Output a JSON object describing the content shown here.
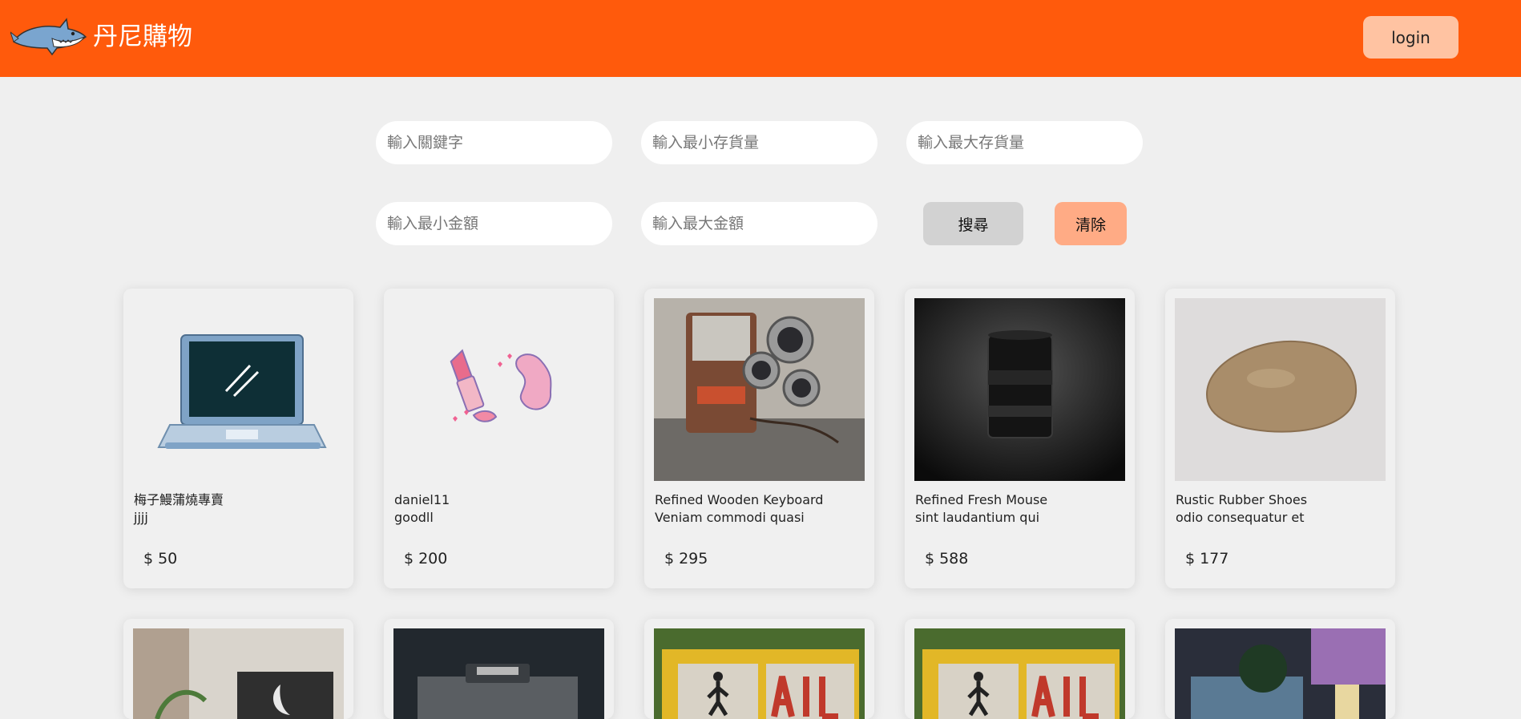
{
  "header": {
    "brand": "丹尼購物",
    "login_label": "login"
  },
  "filters": {
    "keyword_placeholder": "輸入關鍵字",
    "min_stock_placeholder": "輸入最小存貨量",
    "max_stock_placeholder": "輸入最大存貨量",
    "min_price_placeholder": "輸入最小金額",
    "max_price_placeholder": "輸入最大金額",
    "search_label": "搜尋",
    "clear_label": "清除"
  },
  "products": [
    {
      "title": "梅子鰻蒲燒專賣",
      "desc": "jjjj",
      "currency": "$",
      "price": "50",
      "image": "laptop-illustration"
    },
    {
      "title": "daniel11",
      "desc": "goodll",
      "currency": "$",
      "price": "200",
      "image": "cosmetics-illustration"
    },
    {
      "title": "Refined Wooden Keyboard",
      "desc": "Veniam commodi quasi",
      "currency": "$",
      "price": "295",
      "image": "vintage-movie-camera-photo"
    },
    {
      "title": "Refined Fresh Mouse",
      "desc": "sint laudantium qui",
      "currency": "$",
      "price": "588",
      "image": "camera-lens-photo"
    },
    {
      "title": "Rustic Rubber Shoes",
      "desc": "odio consequatur et",
      "currency": "$",
      "price": "177",
      "image": "rock-photo"
    }
  ],
  "row2_images": [
    "plant-and-pillow-photo",
    "fujifilm-camera-photo",
    "pedestrian-signal-photo",
    "pedestrian-signal-photo",
    "night-street-photo"
  ],
  "colors": {
    "header_bg": "#ff5a0c",
    "login_bg": "#ffc3a2",
    "search_bg": "#d2d2d2",
    "clear_bg": "#ffab85",
    "page_bg": "#efefef"
  }
}
